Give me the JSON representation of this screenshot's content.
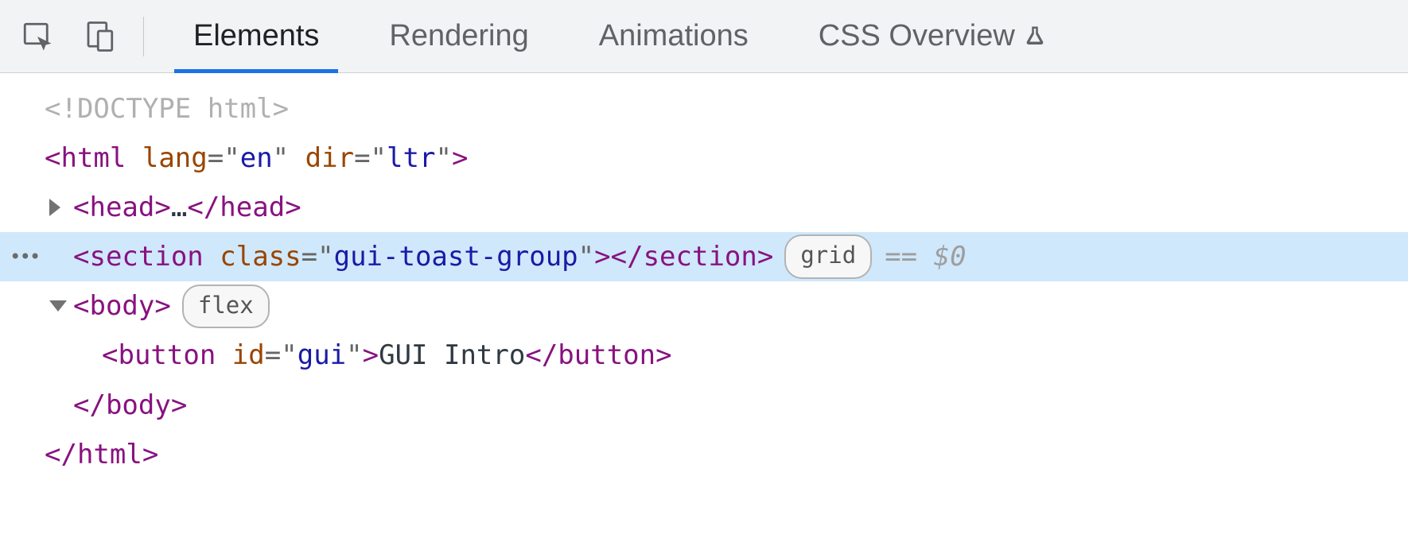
{
  "tabs": {
    "elements": "Elements",
    "rendering": "Rendering",
    "animations": "Animations",
    "css_overview": "CSS Overview"
  },
  "dom": {
    "doctype": "<!DOCTYPE html>",
    "html_open": {
      "tag": "html",
      "attrs": [
        [
          "lang",
          "en"
        ],
        [
          "dir",
          "ltr"
        ]
      ]
    },
    "head": {
      "tag": "head",
      "ellipsis": "…"
    },
    "section": {
      "tag": "section",
      "class": "gui-toast-group",
      "badge": "grid",
      "hint": "== $0"
    },
    "body": {
      "tag": "body",
      "badge": "flex"
    },
    "button": {
      "tag": "button",
      "id": "gui",
      "text": " GUI Intro "
    },
    "body_close": "</body>",
    "html_close": "</html>"
  }
}
